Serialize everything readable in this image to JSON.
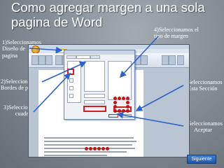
{
  "title": {
    "line1": "Como agregar margen a una sola",
    "line2": "pagina de Word"
  },
  "steps": {
    "s1": [
      "1)Seleccionamos",
      "Diseño de",
      "pagina"
    ],
    "s2": [
      "2)Seleccionamos",
      "Bordes de pagina"
    ],
    "s3": [
      "3)Seleccionamos",
      "cuadro"
    ],
    "s4": [
      "4)Seleccionamos el",
      "tipo de margen"
    ],
    "s5": [
      "5)Seleccionamos",
      "Esta Sección"
    ],
    "s6": [
      "6)Seleccionamos",
      "Aceptar"
    ]
  },
  "nav": {
    "next_label": "Siguiente"
  },
  "colors": {
    "background": "#7d858e",
    "arrow": "#2a62c9",
    "highlight": "#d41e1e",
    "next_button": "#2a6bc4"
  }
}
